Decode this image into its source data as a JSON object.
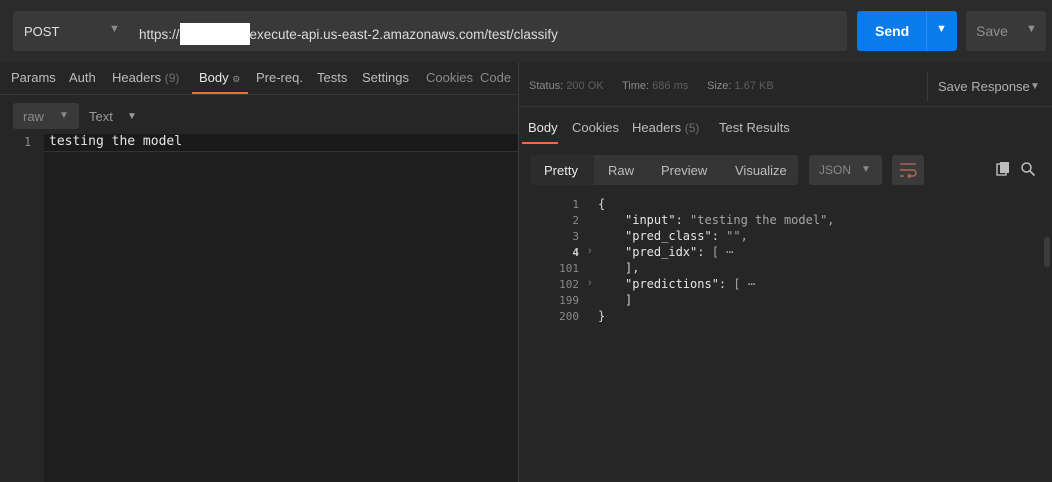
{
  "request": {
    "method": "POST",
    "url_prefix": "https://",
    "url_suffix": "execute-api.us-east-2.amazonaws.com/test/classify",
    "send_label": "Send",
    "save_label": "Save"
  },
  "request_tabs": [
    {
      "label": "Params"
    },
    {
      "label": "Auth"
    },
    {
      "label": "Headers",
      "count": "(9)"
    },
    {
      "label": "Body"
    },
    {
      "label": "Pre-req."
    },
    {
      "label": "Tests"
    },
    {
      "label": "Settings"
    },
    {
      "label": "Cookies"
    },
    {
      "label": "Code"
    }
  ],
  "body": {
    "mode": "raw",
    "format": "Text",
    "lines": [
      {
        "num": "1",
        "text": "testing the model"
      }
    ]
  },
  "response": {
    "status_label": "Status:",
    "status_value": "200 OK",
    "time_label": "Time:",
    "time_value": "686 ms",
    "size_label": "Size:",
    "size_value": "1.67 KB",
    "save_response_label": "Save Response",
    "tabs": [
      {
        "label": "Body"
      },
      {
        "label": "Cookies"
      },
      {
        "label": "Headers",
        "count": "(5)"
      },
      {
        "label": "Test Results"
      }
    ],
    "view_modes": [
      "Pretty",
      "Raw",
      "Preview",
      "Visualize"
    ],
    "language": "JSON",
    "lines": [
      {
        "num": "1",
        "text": "{"
      },
      {
        "num": "2",
        "key": "\"input\"",
        "value": "\"testing the model\","
      },
      {
        "num": "3",
        "key": "\"pred_class\"",
        "value": "\"\","
      },
      {
        "num": "4",
        "key": "\"pred_idx\"",
        "value": "[ ⋯"
      },
      {
        "num": "101",
        "text": "],"
      },
      {
        "num": "102",
        "key": "\"predictions\"",
        "value": "[ ⋯"
      },
      {
        "num": "199",
        "text": "]"
      },
      {
        "num": "200",
        "text": "}"
      }
    ]
  },
  "colors": {
    "accent_orange": "#f26b3a",
    "send_blue": "#097bed"
  },
  "icons": [
    "chevron-down-icon",
    "wrap-lines-icon",
    "copy-icon",
    "search-icon",
    "fold-chevron-icon",
    "settings-dot-icon"
  ]
}
